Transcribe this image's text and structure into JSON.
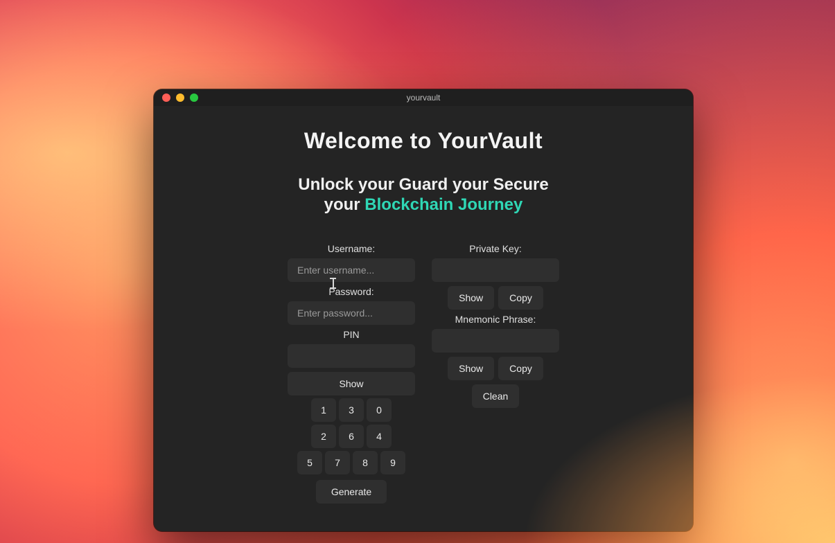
{
  "window": {
    "title": "yourvault"
  },
  "traffic_lights": {
    "close": "close",
    "minimize": "minimize",
    "zoom": "zoom"
  },
  "header": {
    "welcome": "Welcome to YourVault"
  },
  "tagline": {
    "part1": "Unlock your ",
    "part2": " Guard your ",
    "part3": " Secure your ",
    "accent": "Blockchain Journey"
  },
  "left": {
    "username_label": "Username:",
    "username_placeholder": "Enter username...",
    "username_value": "",
    "password_label": "Password:",
    "password_placeholder": "Enter password...",
    "password_value": "",
    "pin_label": "PIN",
    "pin_value": "",
    "show_label": "Show",
    "keypad_rows": [
      [
        "1",
        "3",
        "0"
      ],
      [
        "2",
        "6",
        "4"
      ],
      [
        "5",
        "7",
        "8",
        "9"
      ]
    ],
    "generate_label": "Generate"
  },
  "right": {
    "private_key_label": "Private Key:",
    "private_key_value": "",
    "pk_show_label": "Show",
    "pk_copy_label": "Copy",
    "mnemonic_label": "Mnemonic Phrase:",
    "mnemonic_value": "",
    "mn_show_label": "Show",
    "mn_copy_label": "Copy",
    "clean_label": "Clean"
  },
  "colors": {
    "window_bg": "#242424",
    "field_bg": "#2f2f2f",
    "text": "#e8e8e8",
    "accent": "#2fd7b5"
  }
}
